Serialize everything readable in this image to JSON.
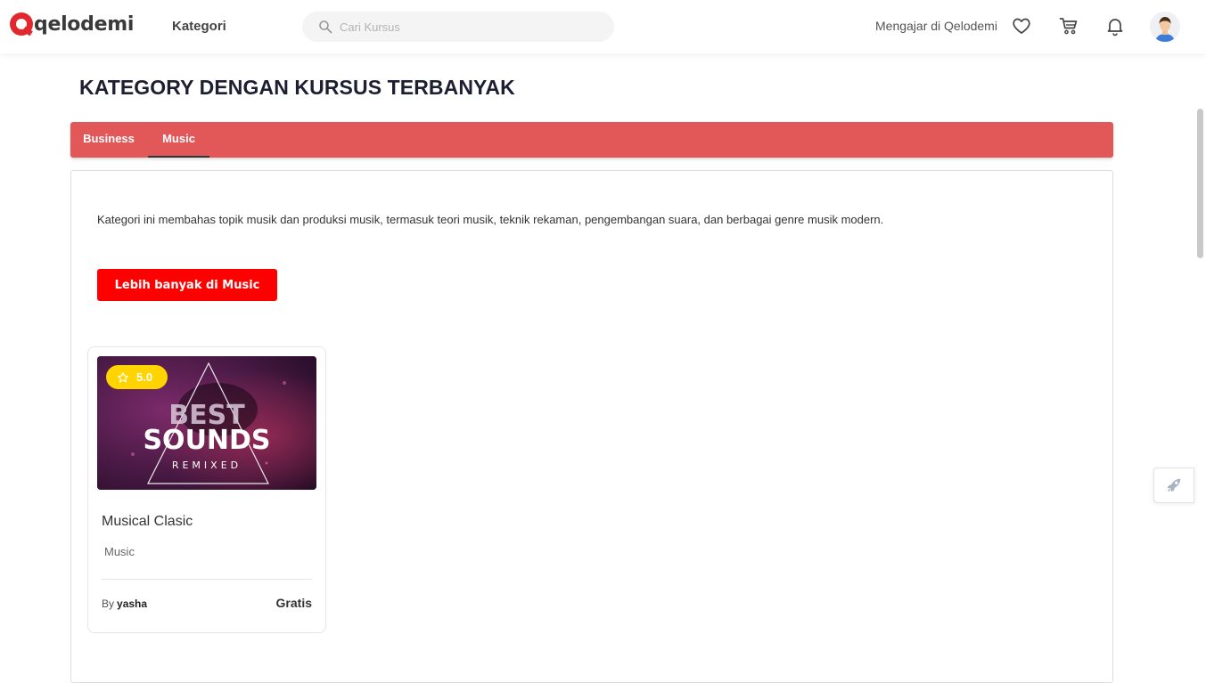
{
  "header": {
    "logo_text": "qelodemi",
    "nav_kategori": "Kategori",
    "search_placeholder": "Cari Kursus",
    "teach_link": "Mengajar di Qelodemi"
  },
  "section": {
    "title": "KATEGORY DENGAN KURSUS TERBANYAK"
  },
  "tabs": [
    {
      "label": "Business",
      "active": false
    },
    {
      "label": "Music",
      "active": true
    }
  ],
  "panel": {
    "description": "Kategori ini membahas topik musik dan produksi musik, termasuk teori musik, teknik rekaman, pengembangan suara, dan berbagai genre musik modern.",
    "more_button": "Lebih banyak di Music"
  },
  "course": {
    "rating": "5.0",
    "image_text_line1": "BEST",
    "image_text_line2": "SOUNDS",
    "image_text_line3": "REMIXED",
    "title": "Musical Clasic",
    "category": "Music",
    "by_label": "By",
    "author": "yasha",
    "price": "Gratis"
  },
  "colors": {
    "brand": "#e0282e",
    "tab_bar": "#e25858",
    "button": "#ff0000",
    "rating_badge": "#ffd400"
  },
  "icons": [
    "search-icon",
    "heart-icon",
    "cart-icon",
    "bell-icon",
    "avatar",
    "star-icon",
    "rocket-icon"
  ]
}
